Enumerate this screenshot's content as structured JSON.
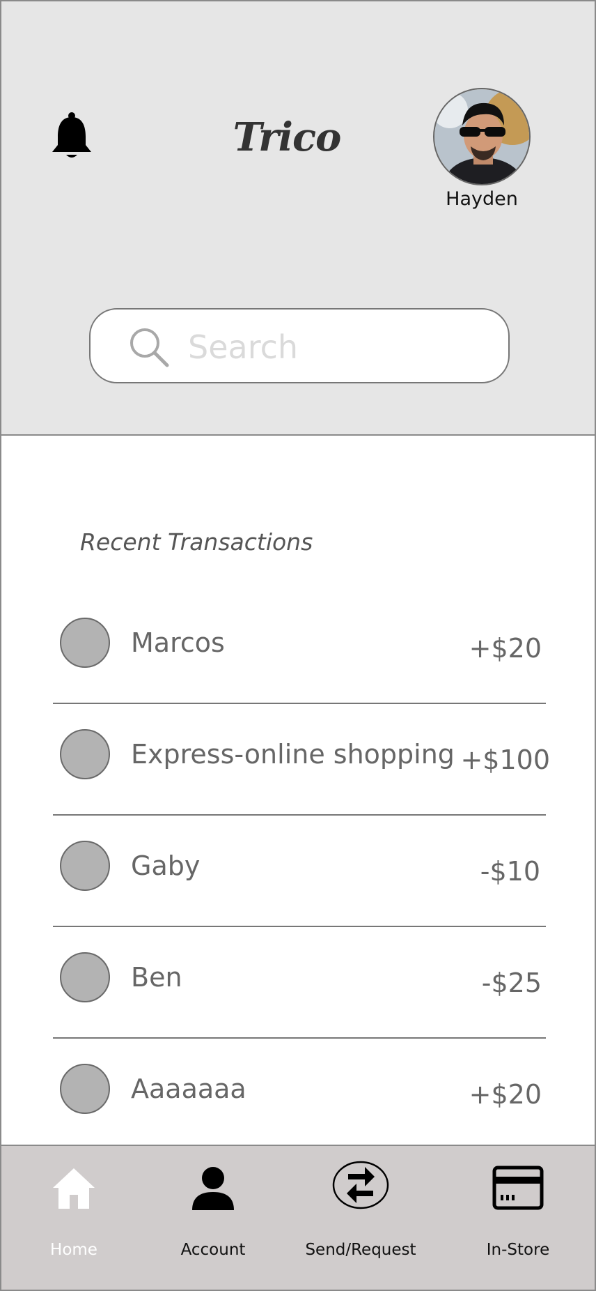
{
  "header": {
    "app_name": "Trico",
    "user_name": "Hayden",
    "notification_icon": "bell-icon",
    "avatar_icon": "user-avatar-photo"
  },
  "search": {
    "placeholder": "Search",
    "icon": "search-icon"
  },
  "transactions": {
    "title": "Recent Transactions",
    "items": [
      {
        "name": "Marcos",
        "amount": "+$20"
      },
      {
        "name": "Express-online shopping",
        "amount": "+$100"
      },
      {
        "name": "Gaby",
        "amount": "-$10"
      },
      {
        "name": "Ben",
        "amount": "-$25"
      },
      {
        "name": "Aaaaaaa",
        "amount": "+$20"
      }
    ]
  },
  "nav": {
    "items": [
      {
        "label": "Home",
        "icon": "home-icon",
        "active": true
      },
      {
        "label": "Account",
        "icon": "person-icon"
      },
      {
        "label": "Send/Request",
        "icon": "swap-arrows-icon"
      },
      {
        "label": "In-Store",
        "icon": "card-icon"
      }
    ]
  },
  "colors": {
    "header_bg": "#e6e6e6",
    "nav_bg": "#d0cccc",
    "placeholder_circle": "#b3b3b3",
    "text_muted": "#666666"
  }
}
